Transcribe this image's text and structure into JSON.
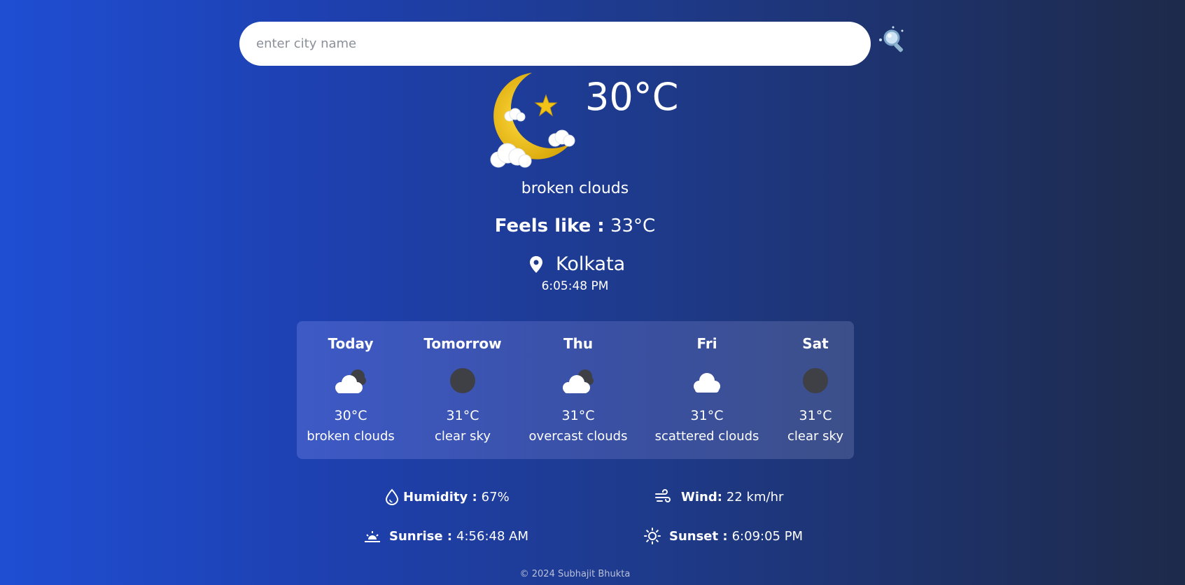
{
  "search": {
    "placeholder": "enter city name",
    "value": "",
    "button_icon": "search-icon"
  },
  "current": {
    "icon": "moon-clouds-icon",
    "temperature": "30°C",
    "description": "broken clouds",
    "feels_like_label": "Feels like :",
    "feels_like_value": "33°C",
    "location_icon": "map-pin-icon",
    "city": "Kolkata",
    "time": "6:05:48 PM"
  },
  "forecast": [
    {
      "day": "Today",
      "icon": "cloud-moon-icon",
      "temp": "30°C",
      "desc": "broken clouds"
    },
    {
      "day": "Tomorrow",
      "icon": "moon-icon",
      "temp": "31°C",
      "desc": "clear sky"
    },
    {
      "day": "Thu",
      "icon": "cloud-moon-icon",
      "temp": "31°C",
      "desc": "overcast clouds"
    },
    {
      "day": "Fri",
      "icon": "cloud-icon",
      "temp": "31°C",
      "desc": "scattered clouds"
    },
    {
      "day": "Sat",
      "icon": "moon-icon",
      "temp": "31°C",
      "desc": "clear sky"
    }
  ],
  "details": {
    "humidity_label": "Humidity :",
    "humidity_value": "67%",
    "wind_label": "Wind:",
    "wind_value": "22 km/hr",
    "sunrise_label": "Sunrise :",
    "sunrise_value": "4:56:48 AM",
    "sunset_label": "Sunset :",
    "sunset_value": "6:09:05 PM"
  },
  "footer": {
    "text": "© 2024 Subhajit Bhukta"
  },
  "colors": {
    "bg_left": "#1f4ed3",
    "bg_right": "#1e2a4a",
    "moon": "#f2c318",
    "text": "#ffffff"
  }
}
